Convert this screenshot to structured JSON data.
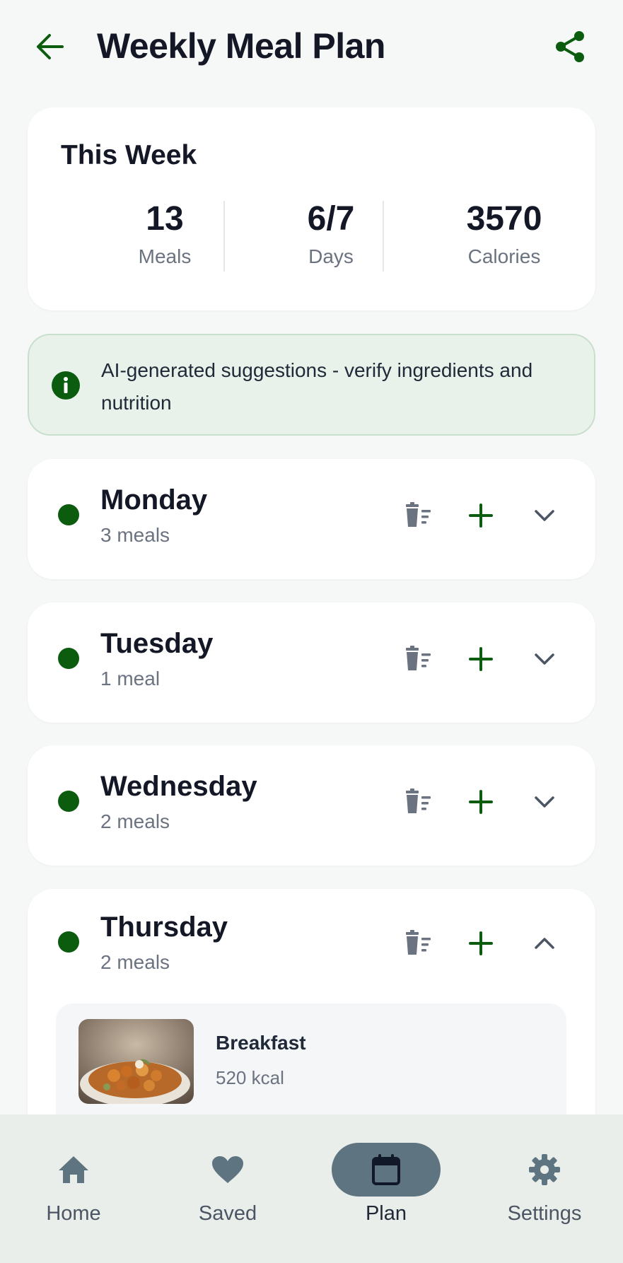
{
  "header": {
    "title": "Weekly Meal Plan"
  },
  "stats": {
    "title": "This Week",
    "items": [
      {
        "value": "13",
        "label": "Meals"
      },
      {
        "value": "6/7",
        "label": "Days"
      },
      {
        "value": "3570",
        "label": "Calories"
      }
    ]
  },
  "info": {
    "text": "AI-generated suggestions - verify ingredients and nutrition"
  },
  "days": [
    {
      "name": "Monday",
      "count": "3 meals",
      "expanded": false
    },
    {
      "name": "Tuesday",
      "count": "1 meal",
      "expanded": false
    },
    {
      "name": "Wednesday",
      "count": "2 meals",
      "expanded": false
    },
    {
      "name": "Thursday",
      "count": "2 meals",
      "expanded": true
    }
  ],
  "thursday_meals": [
    {
      "name": "Breakfast",
      "kcal": "520 kcal"
    }
  ],
  "nav": [
    {
      "label": "Home",
      "icon": "home-icon",
      "active": false
    },
    {
      "label": "Saved",
      "icon": "heart-icon",
      "active": false
    },
    {
      "label": "Plan",
      "icon": "calendar-icon",
      "active": true
    },
    {
      "label": "Settings",
      "icon": "gear-icon",
      "active": false
    }
  ],
  "colors": {
    "accent": "#0b5c0f",
    "nav_active": "#5f7481",
    "info_bg": "#e8f1ea"
  }
}
